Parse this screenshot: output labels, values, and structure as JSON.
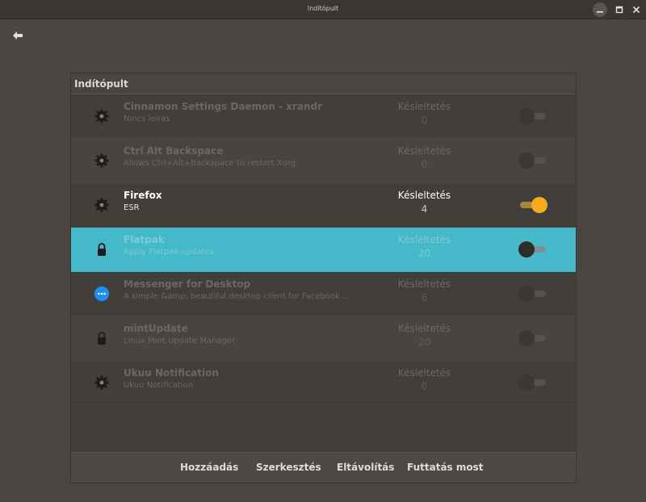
{
  "window": {
    "title": "Indítópult"
  },
  "panel": {
    "header": "Indítópult",
    "delay_label": "Késleltetés"
  },
  "rows": [
    {
      "name": "Cinnamon Settings Daemon - xrandr",
      "desc": "Nincs leírás",
      "delay": "0",
      "icon": "gear-icon",
      "enabled": false
    },
    {
      "name": "Ctrl Alt Backspace",
      "desc": "Allows Ctrl+Alt+Backspace to restart Xorg",
      "delay": "0",
      "icon": "gear-icon",
      "enabled": false
    },
    {
      "name": "Firefox",
      "desc": "ESR",
      "delay": "4",
      "icon": "gear-icon",
      "enabled": true
    },
    {
      "name": "Flatpak",
      "desc": "Apply Flatpak updates",
      "delay": "20",
      "icon": "lock-icon",
      "enabled": false,
      "selected": true
    },
    {
      "name": "Messenger for Desktop",
      "desc": "A simple &amp; beautiful desktop client for Facebook M...",
      "delay": "6",
      "icon": "chat-bubble-icon",
      "enabled": false
    },
    {
      "name": "mintUpdate",
      "desc": "Linux Mint Update Manager",
      "delay": "20",
      "icon": "lock-icon",
      "enabled": false
    },
    {
      "name": "Ukuu Notification",
      "desc": "Ukuu Notification",
      "delay": "0",
      "icon": "gear-icon",
      "enabled": false
    }
  ],
  "footer": {
    "add": "Hozzáadás",
    "edit": "Szerkesztés",
    "remove": "Eltávolítás",
    "run_now": "Futtatás most"
  },
  "colors": {
    "accent": "#f6ab1f",
    "selection": "#45b8c9"
  }
}
